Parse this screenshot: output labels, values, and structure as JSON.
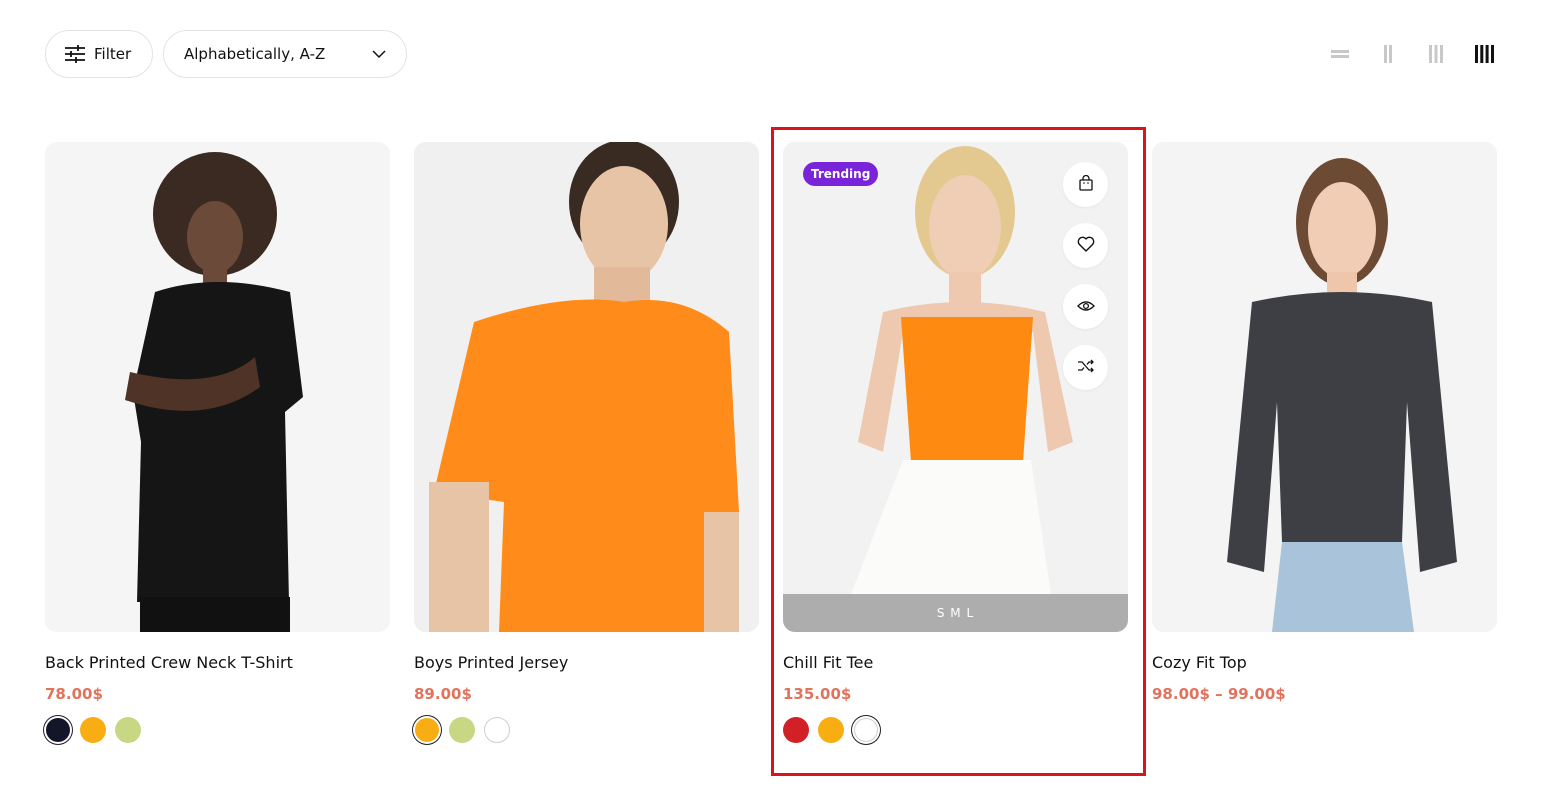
{
  "toolbar": {
    "filter_label": "Filter",
    "filter_icon": "sliders-icon",
    "sort_value": "Alphabetically, A-Z",
    "sort_icon": "chevron-down-icon"
  },
  "layout_switch": {
    "options": [
      "list",
      "2-column",
      "3-column",
      "4-column"
    ],
    "active": "4-column"
  },
  "products": [
    {
      "name": "Back Printed Crew Neck T-Shirt",
      "price": "78.00$",
      "swatches": [
        {
          "color": "#111629",
          "active": true
        },
        {
          "color": "#f8ad12",
          "active": false
        },
        {
          "color": "#c8d783",
          "active": false
        }
      ]
    },
    {
      "name": "Boys Printed Jersey",
      "price": "89.00$",
      "swatches": [
        {
          "color": "#f8ad12",
          "active": true
        },
        {
          "color": "#c8d783",
          "active": false
        },
        {
          "color": "#ffffff",
          "active": false
        }
      ]
    },
    {
      "name": "Chill Fit Tee",
      "price": "135.00$",
      "badge": "Trending",
      "sizes": "S M L",
      "actions": [
        "shopping-bag-icon",
        "heart-icon",
        "eye-icon",
        "shuffle-icon"
      ],
      "swatches": [
        {
          "color": "#d22027",
          "active": false
        },
        {
          "color": "#f8ad12",
          "active": false
        },
        {
          "color": "#ffffff",
          "active": true
        }
      ]
    },
    {
      "name": "Cozy Fit Top",
      "price": "98.00$ – 99.00$",
      "swatches": []
    }
  ],
  "colors": {
    "price": "#e2725b",
    "badge_bg": "#7a24d9",
    "highlight": "#d9141b"
  }
}
